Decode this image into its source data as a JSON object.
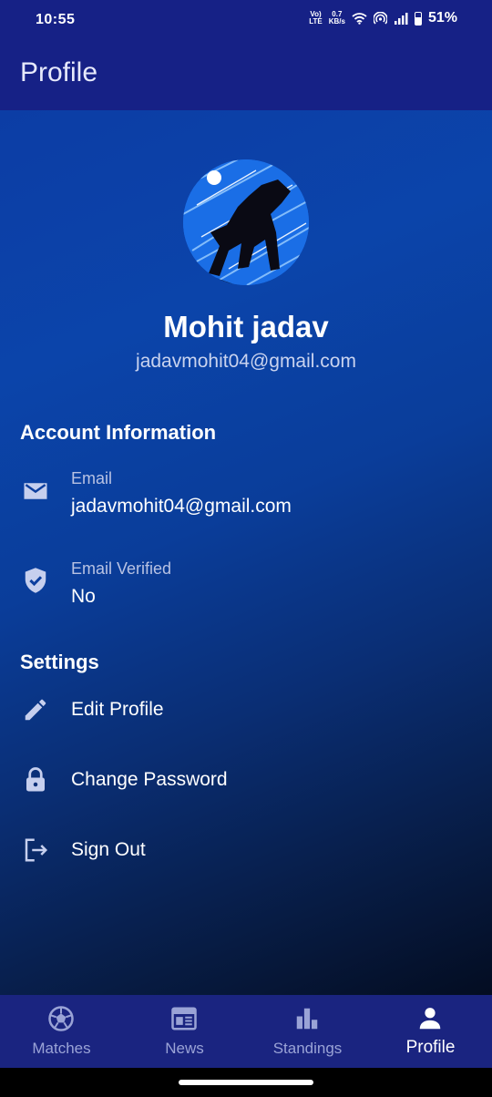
{
  "status": {
    "time": "10:55",
    "volte": "Vo̅ LTE",
    "speed_value": "0.7",
    "speed_unit": "KB/s",
    "battery": "51%"
  },
  "header": {
    "title": "Profile"
  },
  "profile": {
    "name": "Mohit jadav",
    "email": "jadavmohit04@gmail.com"
  },
  "account": {
    "section_title": "Account Information",
    "email_label": "Email",
    "email_value": "jadavmohit04@gmail.com",
    "verified_label": "Email Verified",
    "verified_value": "No"
  },
  "settings": {
    "section_title": "Settings",
    "edit_profile": "Edit Profile",
    "change_password": "Change Password",
    "sign_out": "Sign Out"
  },
  "nav": {
    "items": [
      {
        "label": "Matches",
        "icon": "soccer-ball-icon"
      },
      {
        "label": "News",
        "icon": "newspaper-icon"
      },
      {
        "label": "Standings",
        "icon": "bar-chart-icon"
      },
      {
        "label": "Profile",
        "icon": "person-icon",
        "active": true
      }
    ]
  },
  "colors": {
    "topbar": "#162186",
    "bottom_nav": "#1a2480",
    "inactive_nav": "#9aa3d6",
    "icon": "#c6cfee"
  }
}
